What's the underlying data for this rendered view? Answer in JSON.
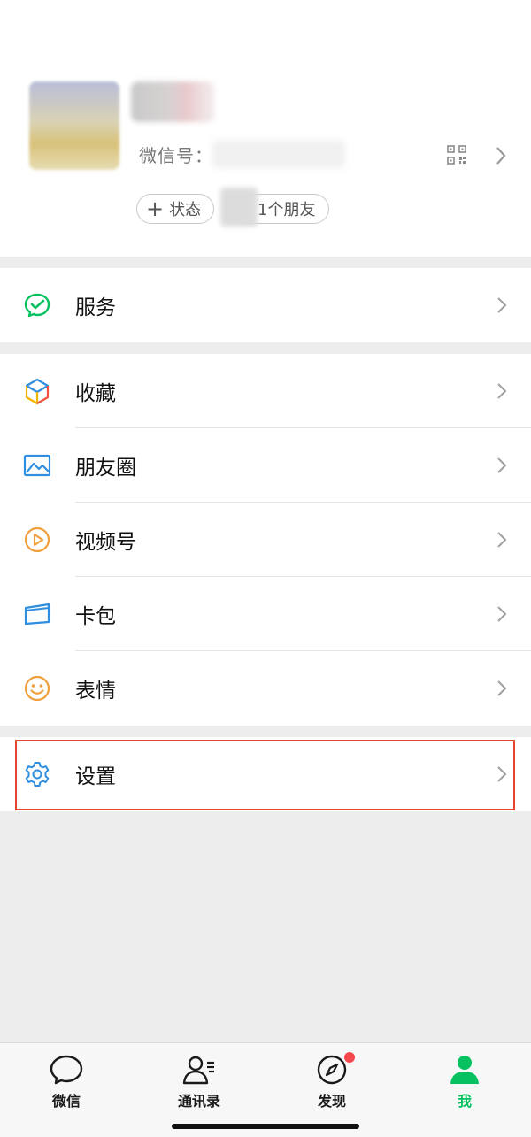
{
  "profile": {
    "wechat_id_label": "微信号：",
    "status_chip": "状态",
    "status_plus": "+",
    "friends_chip": "1个朋友"
  },
  "menu": {
    "services": {
      "label": "服务",
      "icon": "services-icon"
    },
    "favorites": {
      "label": "收藏",
      "icon": "cube-icon"
    },
    "moments": {
      "label": "朋友圈",
      "icon": "image-icon"
    },
    "channels": {
      "label": "视频号",
      "icon": "play-circle-icon"
    },
    "cards": {
      "label": "卡包",
      "icon": "wallet-icon"
    },
    "stickers": {
      "label": "表情",
      "icon": "smiley-icon"
    },
    "settings": {
      "label": "设置",
      "icon": "gear-icon"
    }
  },
  "tabbar": {
    "tabs": [
      {
        "label": "微信",
        "icon": "chat-bubble-icon",
        "active": false
      },
      {
        "label": "通讯录",
        "icon": "contacts-icon",
        "active": false
      },
      {
        "label": "发现",
        "icon": "compass-icon",
        "active": false,
        "badge_dot": true
      },
      {
        "label": "我",
        "icon": "person-icon",
        "active": true
      }
    ]
  },
  "colors": {
    "accent": "#07c160",
    "highlight_border": "#e4462f",
    "badge": "#f5484d",
    "background": "#ededed"
  }
}
